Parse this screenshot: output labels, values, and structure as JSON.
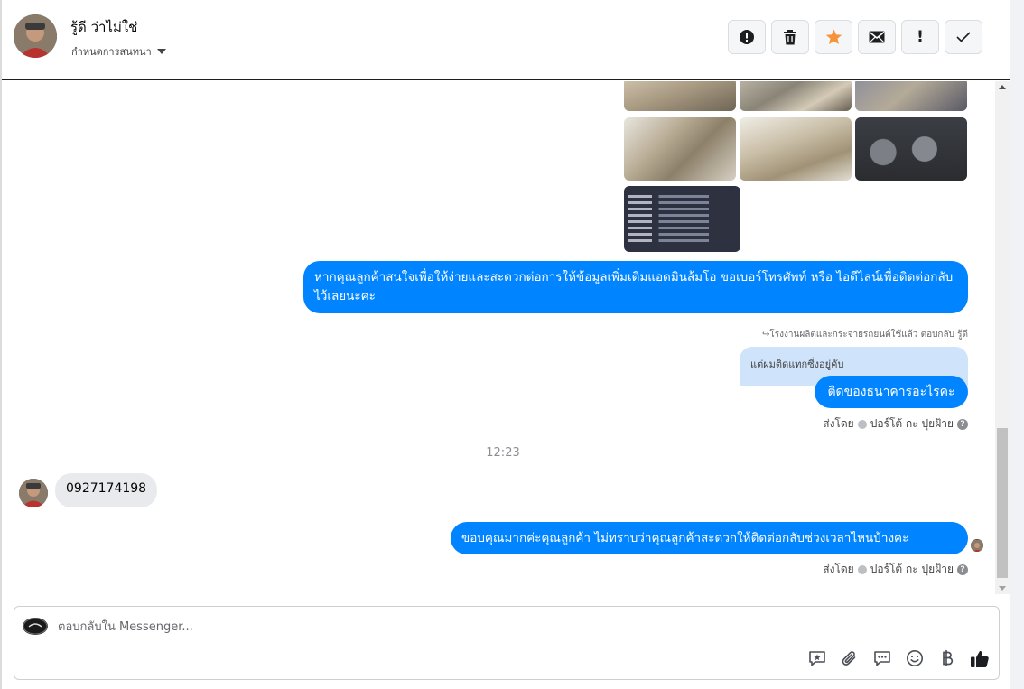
{
  "header": {
    "contact_name": "รู้ดี ว่าไม่ใช่",
    "settings_label": "กำหนดการสนทนา",
    "toolbar": [
      {
        "name": "alert-circle-icon",
        "label": ""
      },
      {
        "name": "trash-icon",
        "label": ""
      },
      {
        "name": "star-icon",
        "label": ""
      },
      {
        "name": "envelope-icon",
        "label": ""
      },
      {
        "name": "exclamation-icon",
        "label": "!"
      },
      {
        "name": "checkmark-icon",
        "label": ""
      }
    ],
    "star_color": "#f7923b"
  },
  "messages": {
    "outgoing_1": "หากคุณลูกค้าสนใจเพื่อให้ง่ายและสะดวกต่อการให้ข้อมูลเพิ่มเติมแอดมินส้มโอ ขอเบอร์โทรศัพท์ หรือ ไอดีไลน์เพื่อติดต่อกลับไว้เลยนะคะ",
    "reply_meta": "↪โรงงานผลิตและกระจายรถยนต์ใช้แล้ว ตอบกลับ รู้ดี",
    "quoted_text": "แต่ผมติดแทกซี่งอยู่คับ",
    "outgoing_2": "ติดของธนาคารอะไรคะ",
    "sent_by_1_prefix": "ส่งโดย",
    "sent_by_1_name": "ปอร์โต้ กะ ปุยฝ้าย",
    "timestamp": "12:23",
    "incoming_1": "0927174198",
    "outgoing_3": "ขอบคุณมากค่ะคุณลูกค้า ไม่ทราบว่าคุณลูกค้าสะดวกให้ติดต่อกลับช่วงเวลาไหนบ้างคะ",
    "sent_by_2_prefix": "ส่งโดย",
    "sent_by_2_name": "ปอร์โต้ กะ ปุยฝ้าย",
    "help_glyph": "?"
  },
  "composer": {
    "placeholder": "ตอบกลับใน Messenger...",
    "tools": [
      "saved-reply-icon",
      "attachment-icon",
      "quick-reply-icon",
      "emoji-icon",
      "baht-icon",
      "thumbs-up-icon"
    ]
  },
  "colors": {
    "outgoing_bubble": "#0084ff",
    "incoming_bubble": "#e9eaed",
    "quoted_bubble": "#cfe3fb"
  }
}
